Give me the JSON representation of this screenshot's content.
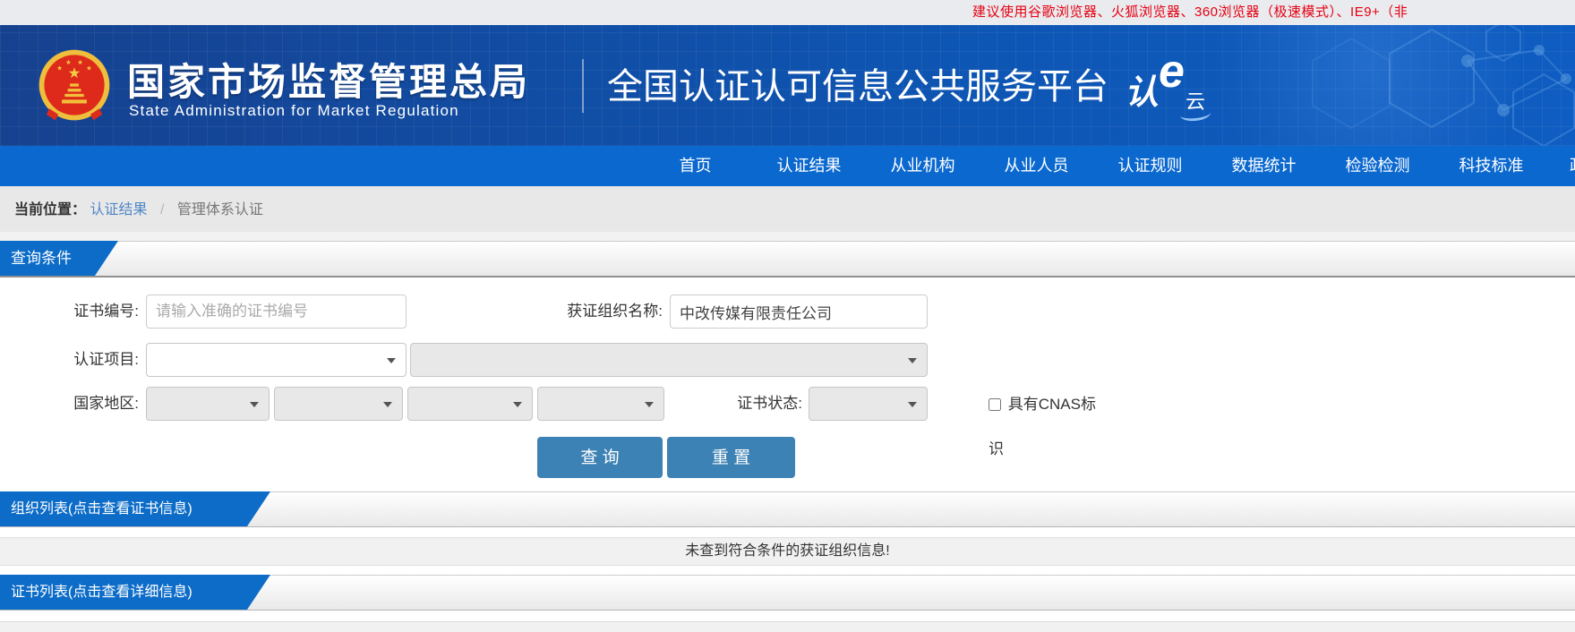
{
  "notice": {
    "text": "建议使用谷歌浏览器、火狐浏览器、360浏览器（极速模式）、IE9+（非"
  },
  "header": {
    "agency_title": "国家市场监督管理总局",
    "agency_subtitle": "State Administration  for  Market Regulation",
    "platform_title": "全国认证认可信息公共服务平台",
    "logo": {
      "ren": "认",
      "e": "e",
      "yun": "云"
    }
  },
  "nav": {
    "items": [
      {
        "label": "首页"
      },
      {
        "label": "认证结果"
      },
      {
        "label": "从业机构"
      },
      {
        "label": "从业人员"
      },
      {
        "label": "认证规则"
      },
      {
        "label": "数据统计"
      },
      {
        "label": "检验检测"
      },
      {
        "label": "科技标准"
      }
    ],
    "partial_item": "政"
  },
  "breadcrumb": {
    "prefix": "当前位置：",
    "link": "认证结果",
    "separator": "/",
    "current": "管理体系认证"
  },
  "sections": {
    "query_title": "查询条件",
    "org_list_title": "组织列表(点击查看证书信息)",
    "cert_list_title": "证书列表(点击查看详细信息)"
  },
  "form": {
    "cert_no_label": "证书编号:",
    "cert_no_placeholder": "请输入准确的证书编号",
    "org_name_label": "获证组织名称:",
    "org_name_value": "中改传媒有限责任公司",
    "project_label": "认证项目:",
    "region_label": "国家地区:",
    "cert_status_label": "证书状态:",
    "cnas_label": "具有CNAS标识",
    "search_button": "查 询",
    "reset_button": "重 置"
  },
  "results": {
    "empty_org_message": "未查到符合条件的获证组织信息!"
  },
  "colors": {
    "accent_blue": "#0c6cc8",
    "nav_blue": "#0a68cf",
    "header_blue": "#0e55b2",
    "button_blue": "#3d82b4",
    "notice_red": "#e60012",
    "link_blue": "#4f87c6"
  }
}
